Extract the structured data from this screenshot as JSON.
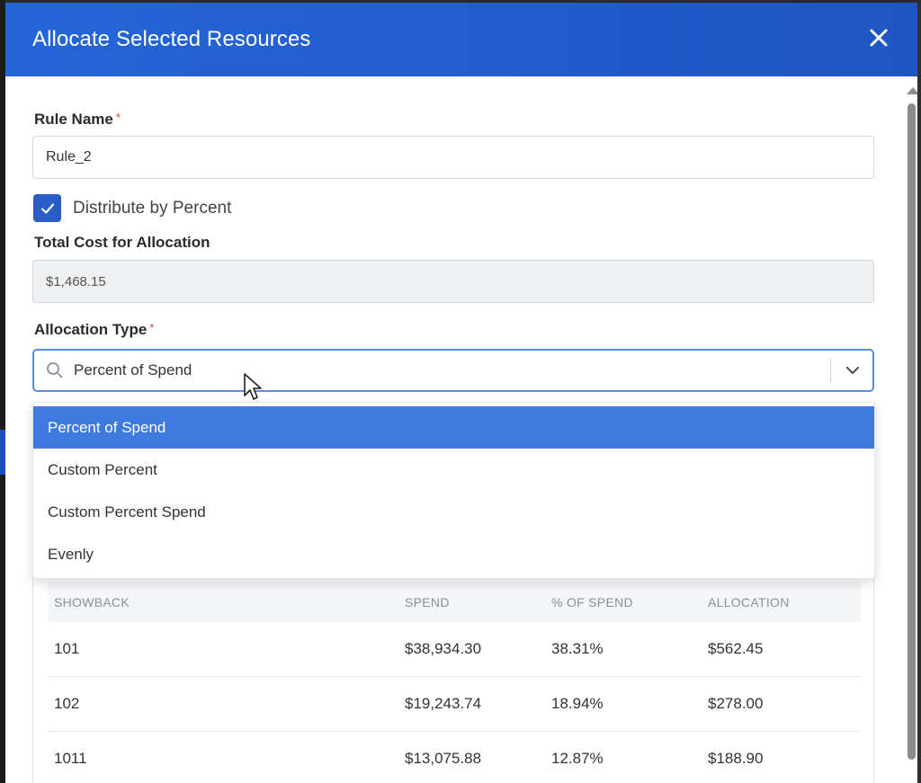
{
  "modal": {
    "title": "Allocate Selected Resources",
    "close_icon": "close-icon"
  },
  "rule_name": {
    "label": "Rule Name",
    "required_mark": "*",
    "value": "Rule_2"
  },
  "distribute": {
    "label": "Distribute by Percent",
    "checked": true
  },
  "total_cost": {
    "label": "Total Cost for Allocation",
    "value": "$1,468.15"
  },
  "allocation_type": {
    "label": "Allocation Type",
    "required_mark": "*",
    "value": "Percent of Spend",
    "options": [
      "Percent of Spend",
      "Custom Percent",
      "Custom Percent Spend",
      "Evenly"
    ],
    "selected_index": 0
  },
  "table": {
    "headers": [
      "SHOWBACK",
      "SPEND",
      "% OF SPEND",
      "ALLOCATION"
    ],
    "rows": [
      [
        "101",
        "$38,934.30",
        "38.31%",
        "$562.45"
      ],
      [
        "102",
        "$19,243.74",
        "18.94%",
        "$278.00"
      ],
      [
        "1011",
        "$13,075.88",
        "12.87%",
        "$188.90"
      ]
    ]
  },
  "colors": {
    "header_blue": "#2566d6",
    "checkbox_blue": "#2a5cc6",
    "selected_option": "#3f7bde",
    "required": "#e0473a"
  }
}
